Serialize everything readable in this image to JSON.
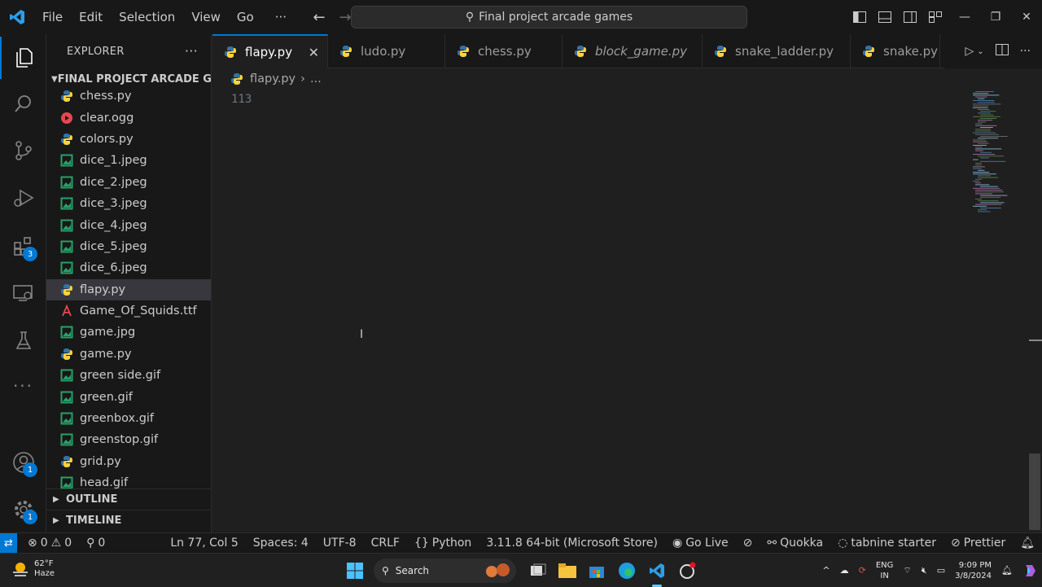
{
  "titlebar": {
    "menu": [
      "File",
      "Edit",
      "Selection",
      "View",
      "Go",
      "···"
    ],
    "search_text": "Final project arcade games"
  },
  "explorer": {
    "title": "EXPLORER",
    "more": "···",
    "folder": "FINAL PROJECT ARCADE G...",
    "files": [
      {
        "name": "chess.py",
        "icon": "python-icon"
      },
      {
        "name": "clear.ogg",
        "icon": "audio-icon"
      },
      {
        "name": "colors.py",
        "icon": "python-icon"
      },
      {
        "name": "dice_1.jpeg",
        "icon": "image-icon"
      },
      {
        "name": "dice_2.jpeg",
        "icon": "image-icon"
      },
      {
        "name": "dice_3.jpeg",
        "icon": "image-icon"
      },
      {
        "name": "dice_4.jpeg",
        "icon": "image-icon"
      },
      {
        "name": "dice_5.jpeg",
        "icon": "image-icon"
      },
      {
        "name": "dice_6.jpeg",
        "icon": "image-icon"
      },
      {
        "name": "flapy.py",
        "icon": "python-icon",
        "selected": true
      },
      {
        "name": "Game_Of_Squids.ttf",
        "icon": "font-icon"
      },
      {
        "name": "game.jpg",
        "icon": "image-icon"
      },
      {
        "name": "game.py",
        "icon": "python-icon"
      },
      {
        "name": "green side.gif",
        "icon": "image-icon"
      },
      {
        "name": "green.gif",
        "icon": "image-icon"
      },
      {
        "name": "greenbox.gif",
        "icon": "image-icon"
      },
      {
        "name": "greenstop.gif",
        "icon": "image-icon"
      },
      {
        "name": "grid.py",
        "icon": "python-icon"
      },
      {
        "name": "head.gif",
        "icon": "image-icon"
      }
    ],
    "outline": "OUTLINE",
    "timeline": "TIMELINE"
  },
  "activity": {
    "extensions_badge": "3",
    "accounts_badge": "1",
    "settings_badge": "1"
  },
  "tabs": [
    {
      "label": "flapy.py",
      "active": true,
      "width": 142
    },
    {
      "label": "ludo.py",
      "width": 144
    },
    {
      "label": "chess.py",
      "width": 144
    },
    {
      "label": "block_game.py",
      "italic": true,
      "width": 172
    },
    {
      "label": "snake_ladder.py",
      "width": 182
    },
    {
      "label": "snake.py",
      "width": 110
    }
  ],
  "breadcrumb": {
    "file": "flapy.py",
    "more": "..."
  },
  "editor": {
    "line_number": "113"
  },
  "statusbar": {
    "errors": "0",
    "warnings": "0",
    "ports": "0",
    "position": "Ln 77, Col 5",
    "spaces": "Spaces: 4",
    "encoding": "UTF-8",
    "eol": "CRLF",
    "language": "Python",
    "interpreter": "3.11.8 64-bit (Microsoft Store)",
    "golive": "Go Live",
    "quokka": "Quokka",
    "tabnine": "tabnine starter",
    "prettier": "Prettier"
  },
  "taskbar": {
    "temp": "62°F",
    "weather": "Haze",
    "search": "Search",
    "lang1": "ENG",
    "lang2": "IN",
    "time": "9:09 PM",
    "date": "3/8/2024"
  },
  "colors": {
    "accent": "#0078d4",
    "python_blue": "#3572a5",
    "python_yellow": "#ffd43b",
    "image_green": "#26a269"
  }
}
